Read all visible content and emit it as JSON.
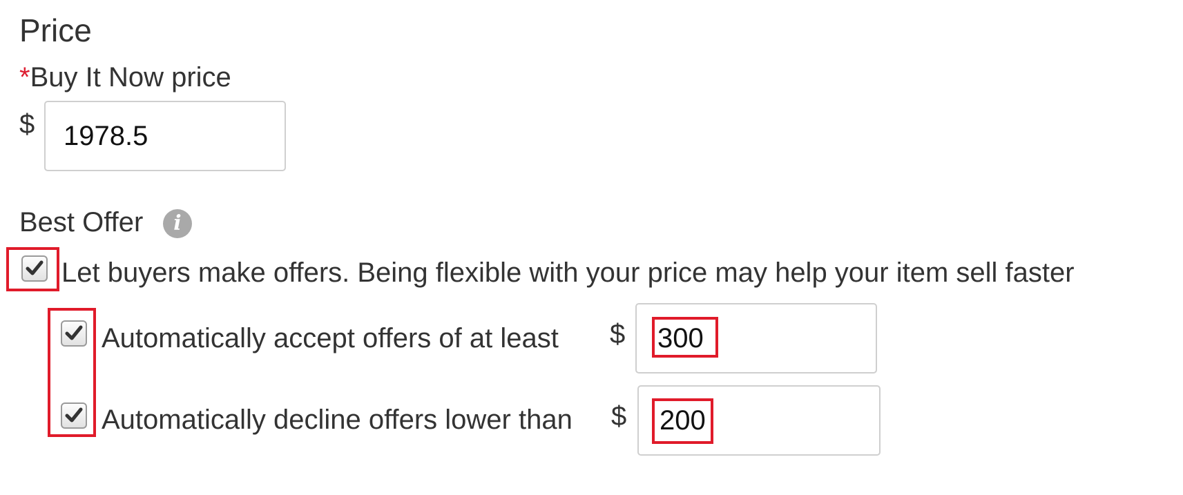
{
  "price_section": {
    "title": "Price",
    "buy_it_now": {
      "required_marker": "*",
      "label": "Buy It Now price",
      "currency": "$",
      "value": "1978.5"
    }
  },
  "best_offer": {
    "title": "Best Offer",
    "info_icon": "info-icon",
    "allow_offers": {
      "checked": true,
      "label": "Let buyers make offers. Being flexible with your price may help your item sell faster"
    },
    "auto_accept": {
      "checked": true,
      "label": "Automatically accept offers of at least",
      "currency": "$",
      "value": "300"
    },
    "auto_decline": {
      "checked": true,
      "label": "Automatically decline offers lower than",
      "currency": "$",
      "value": "200"
    }
  },
  "colors": {
    "highlight": "#e01b2a",
    "required": "#dd1e31"
  }
}
